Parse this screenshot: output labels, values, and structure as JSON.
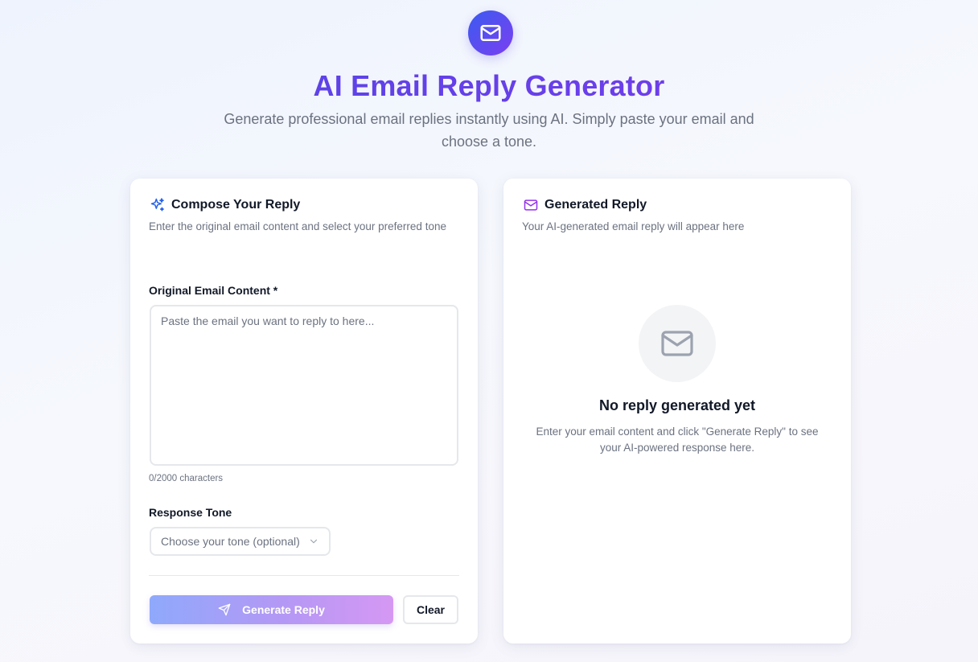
{
  "header": {
    "logo_icon": "mail-icon",
    "title": "AI Email Reply Generator",
    "subtitle": "Generate professional email replies instantly using AI. Simply paste your email and choose a tone."
  },
  "compose": {
    "icon": "sparkles-icon",
    "title": "Compose Your Reply",
    "description": "Enter the original email content and select your preferred tone",
    "email_label": "Original Email Content *",
    "email_placeholder": "Paste the email you want to reply to here...",
    "email_value": "",
    "char_count": "0/2000 characters",
    "tone_label": "Response Tone",
    "tone_placeholder": "Choose your tone (optional)",
    "generate_label": "Generate Reply",
    "clear_label": "Clear"
  },
  "result": {
    "icon": "mail-icon",
    "title": "Generated Reply",
    "description": "Your AI-generated email reply will appear here",
    "empty_title": "No reply generated yet",
    "empty_text": "Enter your email content and click \"Generate Reply\" to see your AI-powered response here."
  },
  "colors": {
    "accent_start": "#4f46e5",
    "accent_end": "#7c3aed",
    "compose_icon": "#2563eb",
    "result_icon": "#9333ea"
  }
}
